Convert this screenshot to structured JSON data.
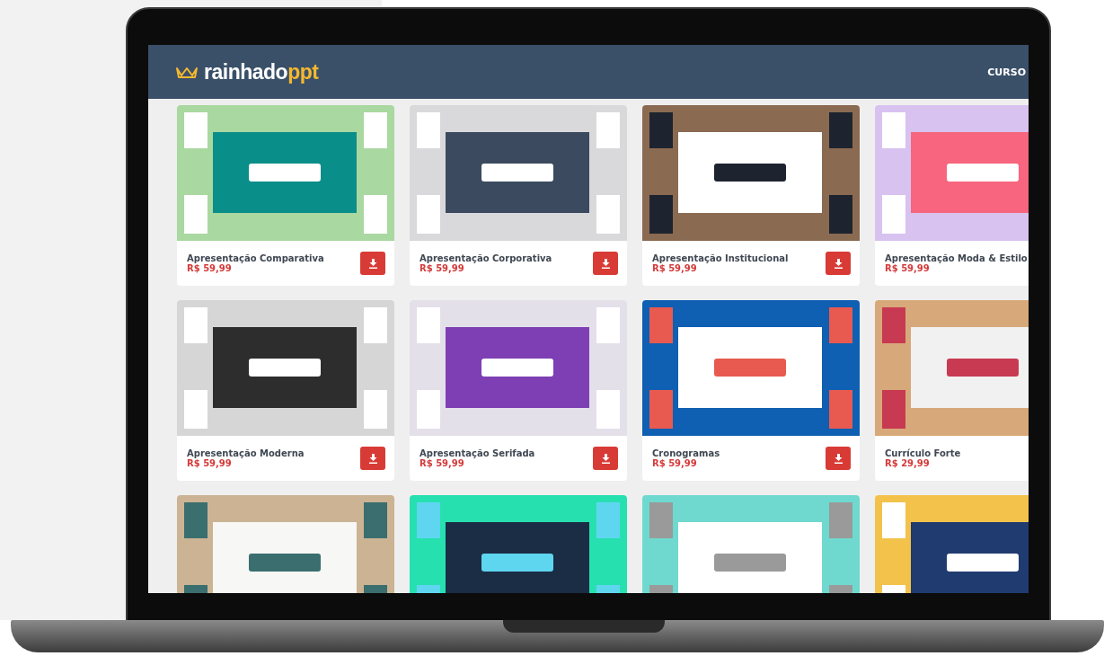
{
  "header": {
    "logo_text": "rainhado",
    "logo_accent": "ppt",
    "nav": [
      "CURSO"
    ]
  },
  "products": [
    {
      "kind": "listing",
      "title": "Apresentação Comparativa",
      "price": "R$ 59,99"
    },
    {
      "kind": "listing",
      "title": "Apresentação Corporativa",
      "price": "R$ 59,99"
    },
    {
      "kind": "listing",
      "title": "Apresentação Institucional",
      "price": "R$ 59,99"
    },
    {
      "kind": "listing",
      "title": "Apresentação Moda & Estilo",
      "price": "R$ 59,99"
    },
    {
      "kind": "listing",
      "title": "Apresentação Moderna",
      "price": "R$ 59,99"
    },
    {
      "kind": "listing",
      "title": "Apresentação Serifada",
      "price": "R$ 59,99"
    },
    {
      "kind": "listing",
      "title": "Cronogramas",
      "price": "R$ 59,99"
    },
    {
      "kind": "listing",
      "title": "Currículo Forte",
      "price": "R$ 29,99"
    },
    {
      "kind": "cropped"
    },
    {
      "kind": "cropped"
    },
    {
      "kind": "cropped"
    },
    {
      "kind": "cropped"
    }
  ]
}
